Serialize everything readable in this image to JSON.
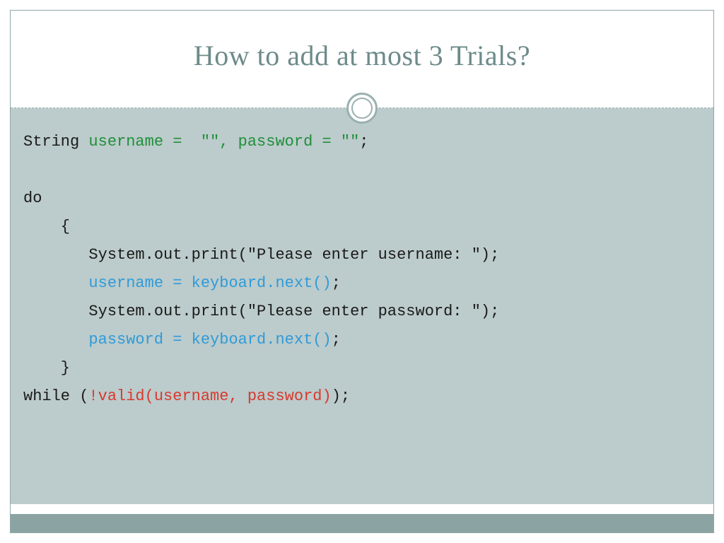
{
  "title": "How to add at most 3 Trials?",
  "code": {
    "l1a": "String ",
    "l1b": "username =  \"\", password = \"\"",
    "l1c": ";",
    "l2": "",
    "l3": "do",
    "l4": "    {",
    "l5": "       System.out.print(\"Please enter username: \");",
    "l6a": "       ",
    "l6b": "username = keyboard.next()",
    "l6c": ";",
    "l7": "       System.out.print(\"Please enter password: \");",
    "l8a": "       ",
    "l8b": "password = keyboard.next()",
    "l8c": ";",
    "l9": "    }",
    "l10a": "while (",
    "l10b": "!valid(username, password)",
    "l10c": ");"
  }
}
